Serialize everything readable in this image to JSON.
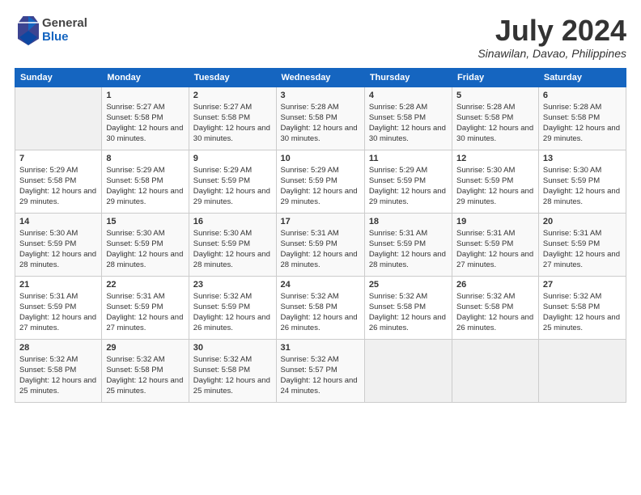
{
  "header": {
    "logo": {
      "line1": "General",
      "line2": "Blue"
    },
    "title": "July 2024",
    "location": "Sinawilan, Davao, Philippines"
  },
  "calendar": {
    "days_of_week": [
      "Sunday",
      "Monday",
      "Tuesday",
      "Wednesday",
      "Thursday",
      "Friday",
      "Saturday"
    ],
    "weeks": [
      [
        {
          "day": "",
          "info": ""
        },
        {
          "day": "1",
          "info": "Sunrise: 5:27 AM\nSunset: 5:58 PM\nDaylight: 12 hours\nand 30 minutes."
        },
        {
          "day": "2",
          "info": "Sunrise: 5:27 AM\nSunset: 5:58 PM\nDaylight: 12 hours\nand 30 minutes."
        },
        {
          "day": "3",
          "info": "Sunrise: 5:28 AM\nSunset: 5:58 PM\nDaylight: 12 hours\nand 30 minutes."
        },
        {
          "day": "4",
          "info": "Sunrise: 5:28 AM\nSunset: 5:58 PM\nDaylight: 12 hours\nand 30 minutes."
        },
        {
          "day": "5",
          "info": "Sunrise: 5:28 AM\nSunset: 5:58 PM\nDaylight: 12 hours\nand 30 minutes."
        },
        {
          "day": "6",
          "info": "Sunrise: 5:28 AM\nSunset: 5:58 PM\nDaylight: 12 hours\nand 29 minutes."
        }
      ],
      [
        {
          "day": "7",
          "info": ""
        },
        {
          "day": "8",
          "info": "Sunrise: 5:29 AM\nSunset: 5:58 PM\nDaylight: 12 hours\nand 29 minutes."
        },
        {
          "day": "9",
          "info": "Sunrise: 5:29 AM\nSunset: 5:59 PM\nDaylight: 12 hours\nand 29 minutes."
        },
        {
          "day": "10",
          "info": "Sunrise: 5:29 AM\nSunset: 5:59 PM\nDaylight: 12 hours\nand 29 minutes."
        },
        {
          "day": "11",
          "info": "Sunrise: 5:29 AM\nSunset: 5:59 PM\nDaylight: 12 hours\nand 29 minutes."
        },
        {
          "day": "12",
          "info": "Sunrise: 5:30 AM\nSunset: 5:59 PM\nDaylight: 12 hours\nand 29 minutes."
        },
        {
          "day": "13",
          "info": "Sunrise: 5:30 AM\nSunset: 5:59 PM\nDaylight: 12 hours\nand 28 minutes."
        }
      ],
      [
        {
          "day": "14",
          "info": ""
        },
        {
          "day": "15",
          "info": "Sunrise: 5:30 AM\nSunset: 5:59 PM\nDaylight: 12 hours\nand 28 minutes."
        },
        {
          "day": "16",
          "info": "Sunrise: 5:30 AM\nSunset: 5:59 PM\nDaylight: 12 hours\nand 28 minutes."
        },
        {
          "day": "17",
          "info": "Sunrise: 5:31 AM\nSunset: 5:59 PM\nDaylight: 12 hours\nand 28 minutes."
        },
        {
          "day": "18",
          "info": "Sunrise: 5:31 AM\nSunset: 5:59 PM\nDaylight: 12 hours\nand 28 minutes."
        },
        {
          "day": "19",
          "info": "Sunrise: 5:31 AM\nSunset: 5:59 PM\nDaylight: 12 hours\nand 27 minutes."
        },
        {
          "day": "20",
          "info": "Sunrise: 5:31 AM\nSunset: 5:59 PM\nDaylight: 12 hours\nand 27 minutes."
        }
      ],
      [
        {
          "day": "21",
          "info": ""
        },
        {
          "day": "22",
          "info": "Sunrise: 5:31 AM\nSunset: 5:59 PM\nDaylight: 12 hours\nand 27 minutes."
        },
        {
          "day": "23",
          "info": "Sunrise: 5:32 AM\nSunset: 5:59 PM\nDaylight: 12 hours\nand 26 minutes."
        },
        {
          "day": "24",
          "info": "Sunrise: 5:32 AM\nSunset: 5:58 PM\nDaylight: 12 hours\nand 26 minutes."
        },
        {
          "day": "25",
          "info": "Sunrise: 5:32 AM\nSunset: 5:58 PM\nDaylight: 12 hours\nand 26 minutes."
        },
        {
          "day": "26",
          "info": "Sunrise: 5:32 AM\nSunset: 5:58 PM\nDaylight: 12 hours\nand 26 minutes."
        },
        {
          "day": "27",
          "info": "Sunrise: 5:32 AM\nSunset: 5:58 PM\nDaylight: 12 hours\nand 25 minutes."
        }
      ],
      [
        {
          "day": "28",
          "info": "Sunrise: 5:32 AM\nSunset: 5:58 PM\nDaylight: 12 hours\nand 25 minutes."
        },
        {
          "day": "29",
          "info": "Sunrise: 5:32 AM\nSunset: 5:58 PM\nDaylight: 12 hours\nand 25 minutes."
        },
        {
          "day": "30",
          "info": "Sunrise: 5:32 AM\nSunset: 5:58 PM\nDaylight: 12 hours\nand 25 minutes."
        },
        {
          "day": "31",
          "info": "Sunrise: 5:32 AM\nSunset: 5:57 PM\nDaylight: 12 hours\nand 24 minutes."
        },
        {
          "day": "",
          "info": ""
        },
        {
          "day": "",
          "info": ""
        },
        {
          "day": "",
          "info": ""
        }
      ]
    ]
  },
  "week7_sunday": "Sunrise: 5:29 AM\nSunset: 5:58 PM\nDaylight: 12 hours\nand 29 minutes.",
  "week3_sunday": "Sunrise: 5:30 AM\nSunset: 5:59 PM\nDaylight: 12 hours\nand 28 minutes.",
  "week4_sunday": "Sunrise: 5:31 AM\nSunset: 5:59 PM\nDaylight: 12 hours\nand 27 minutes."
}
